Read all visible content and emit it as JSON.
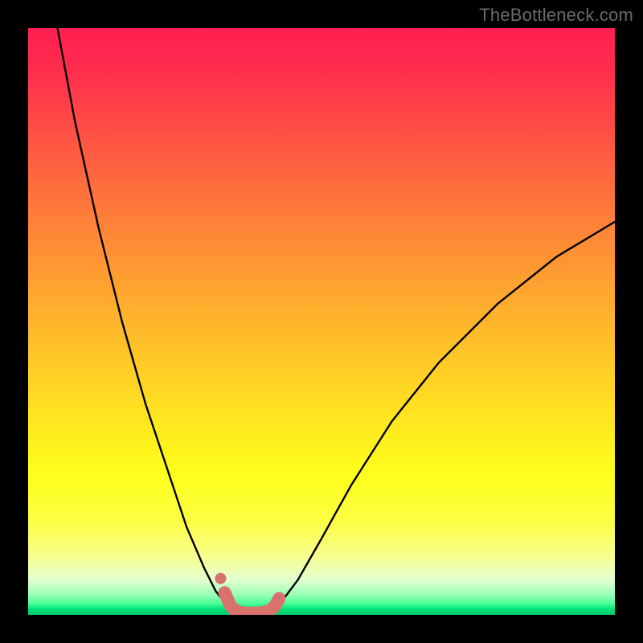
{
  "watermark": "TheBottleneck.com",
  "chart_data": {
    "type": "line",
    "title": "",
    "xlabel": "",
    "ylabel": "",
    "xlim": [
      0,
      100
    ],
    "ylim": [
      0,
      100
    ],
    "series": [
      {
        "name": "left-descent",
        "x": [
          5,
          8,
          12,
          16,
          20,
          24,
          27,
          30,
          32,
          34,
          35.5
        ],
        "values": [
          100,
          84,
          66,
          50,
          36,
          24,
          15,
          8,
          4,
          1.5,
          0.7
        ]
      },
      {
        "name": "right-ascent",
        "x": [
          41,
          43,
          46,
          50,
          55,
          62,
          70,
          80,
          90,
          100
        ],
        "values": [
          0.7,
          2,
          6,
          13,
          22,
          33,
          43,
          53,
          61,
          67
        ]
      },
      {
        "name": "valley-highlight",
        "x": [
          33.5,
          34.5,
          35.5,
          37,
          38.5,
          40,
          41,
          42,
          42.8
        ],
        "values": [
          3.8,
          1.5,
          0.6,
          0.3,
          0.3,
          0.4,
          0.7,
          1.4,
          2.8
        ]
      },
      {
        "name": "left-dot",
        "x": [
          32.8
        ],
        "values": [
          6.2
        ]
      }
    ],
    "gradient_stops": [
      {
        "pos": 0,
        "color": "#ff1f52"
      },
      {
        "pos": 50,
        "color": "#ffb82b"
      },
      {
        "pos": 80,
        "color": "#feff1a"
      },
      {
        "pos": 97,
        "color": "#70ffa5"
      },
      {
        "pos": 100,
        "color": "#00c86d"
      }
    ],
    "highlight_color": "#d9726d",
    "curve_color": "#000000"
  }
}
